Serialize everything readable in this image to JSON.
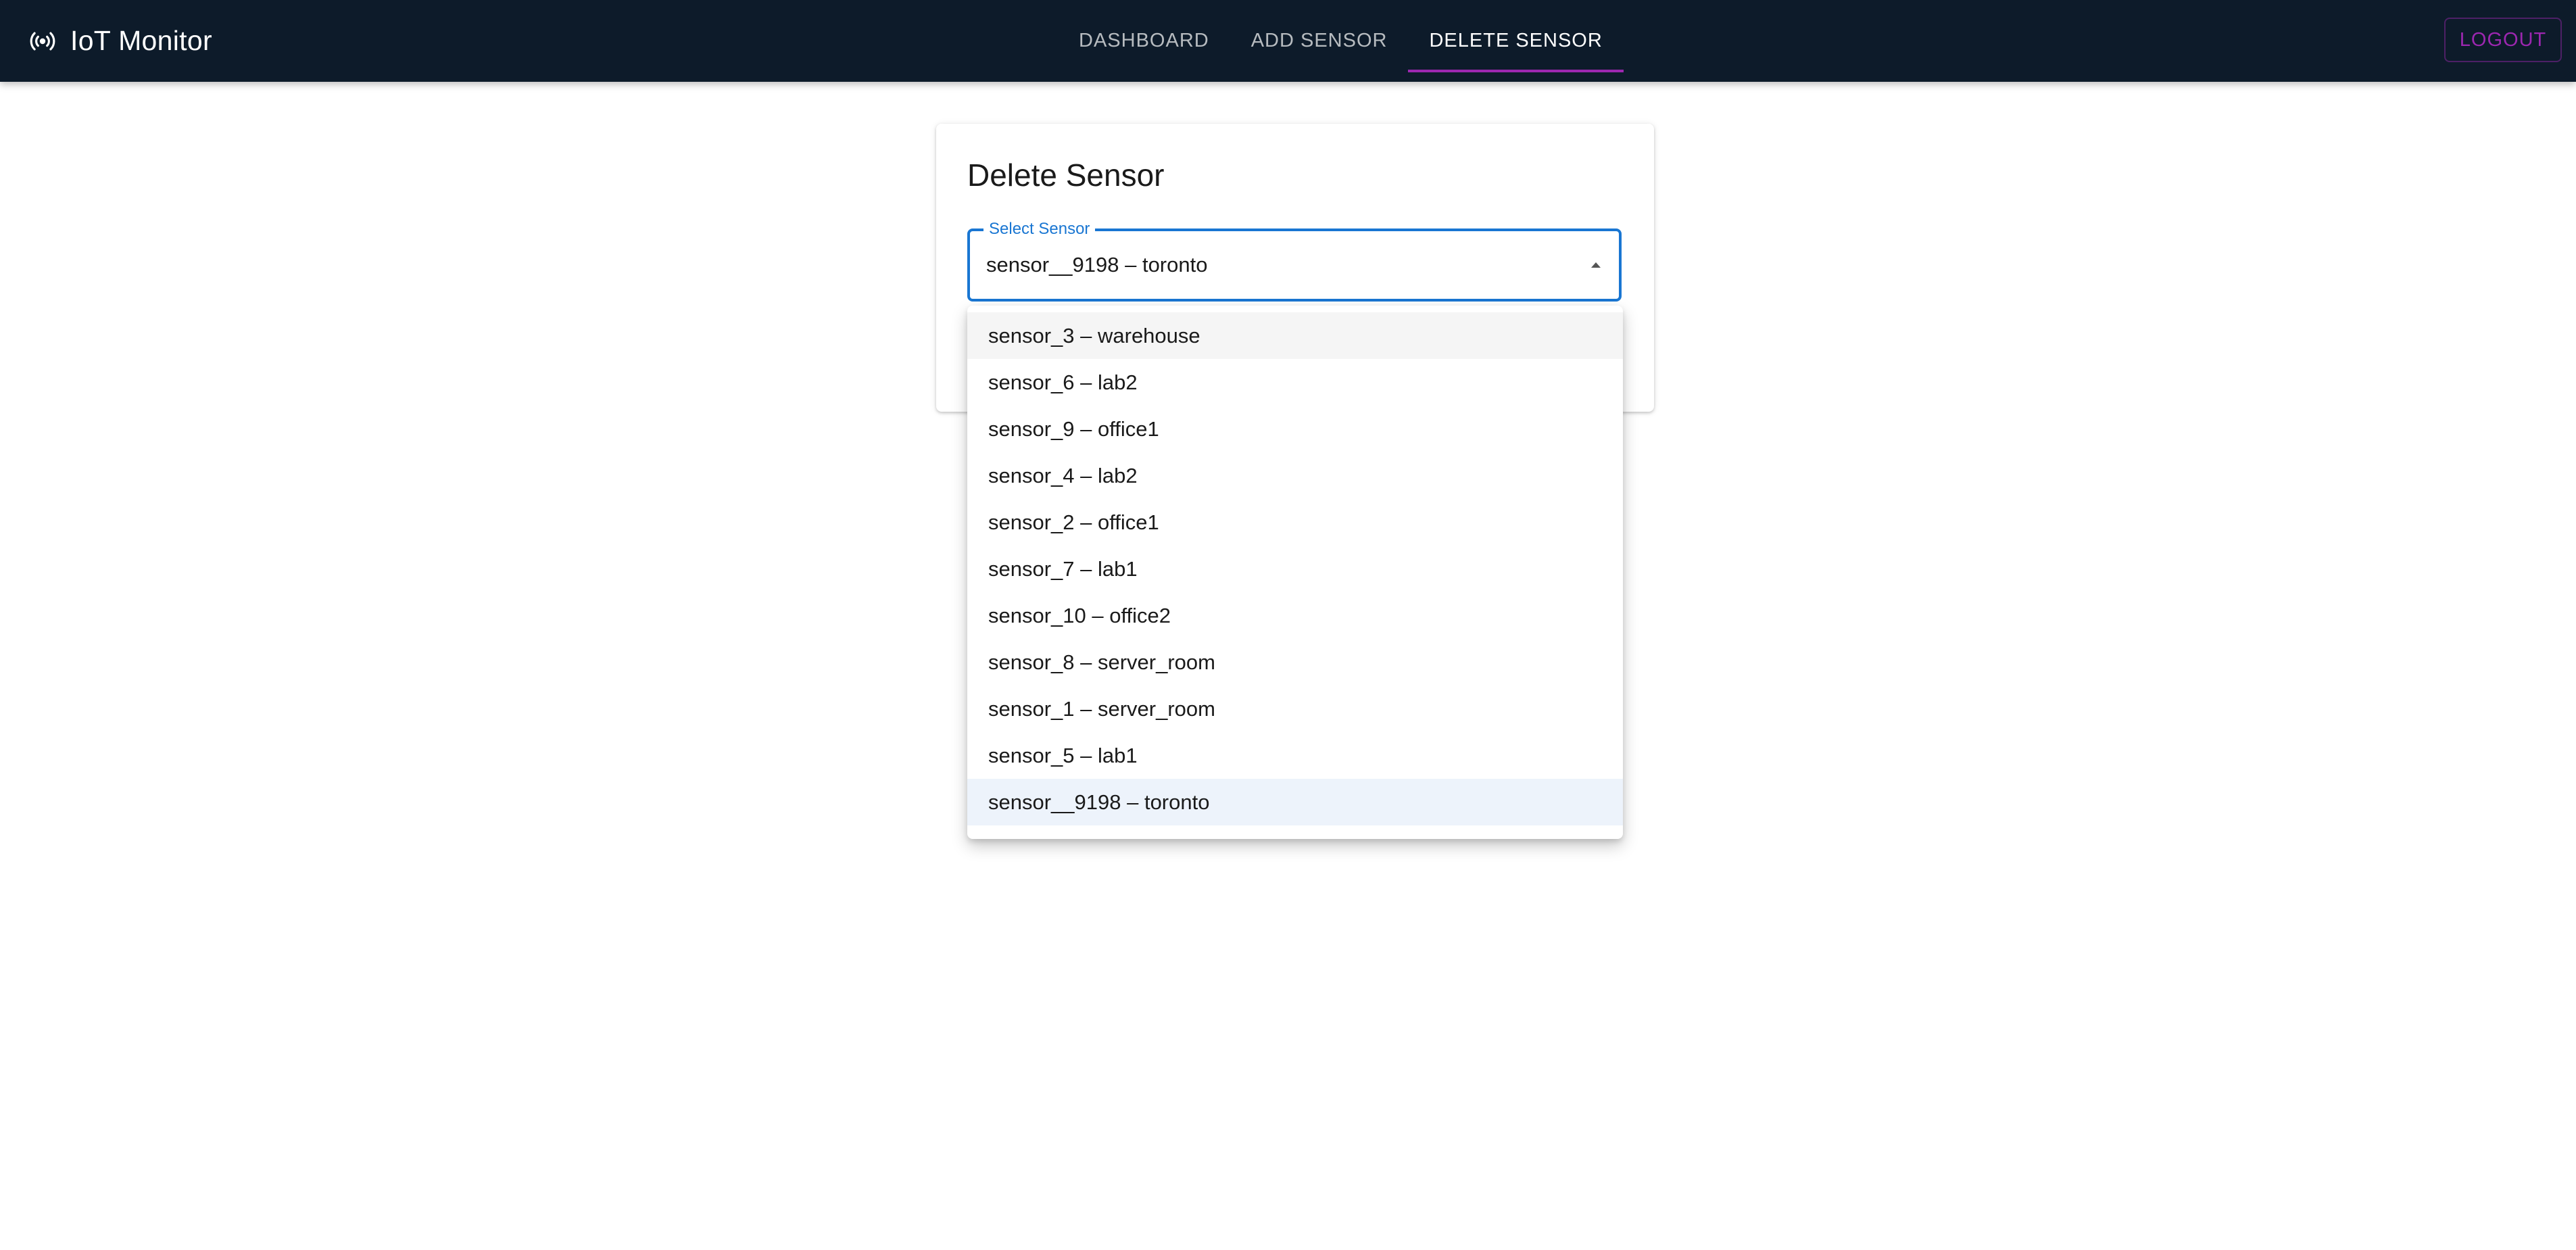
{
  "app": {
    "title": "IoT Monitor",
    "icon": "broadcast-icon"
  },
  "nav": {
    "items": [
      {
        "label": "DASHBOARD",
        "active": false
      },
      {
        "label": "ADD SENSOR",
        "active": false
      },
      {
        "label": "DELETE SENSOR",
        "active": true
      }
    ],
    "logout_label": "LOGOUT"
  },
  "colors": {
    "topbar": "#0d1b2a",
    "accent": "#9c27b0",
    "field_focus": "#1976d2"
  },
  "form": {
    "title": "Delete Sensor",
    "select_label": "Select Sensor",
    "selected_value": "sensor__9198 – toronto",
    "arrow_icon": "arrow-drop-up-icon"
  },
  "menu": {
    "options": [
      "sensor_3 – warehouse",
      "sensor_6 – lab2",
      "sensor_9 – office1",
      "sensor_4 – lab2",
      "sensor_2 – office1",
      "sensor_7 – lab1",
      "sensor_10 – office2",
      "sensor_8 – server_room",
      "sensor_1 – server_room",
      "sensor_5 – lab1",
      "sensor__9198 – toronto"
    ],
    "hovered_index": 0,
    "selected_index": 10
  }
}
